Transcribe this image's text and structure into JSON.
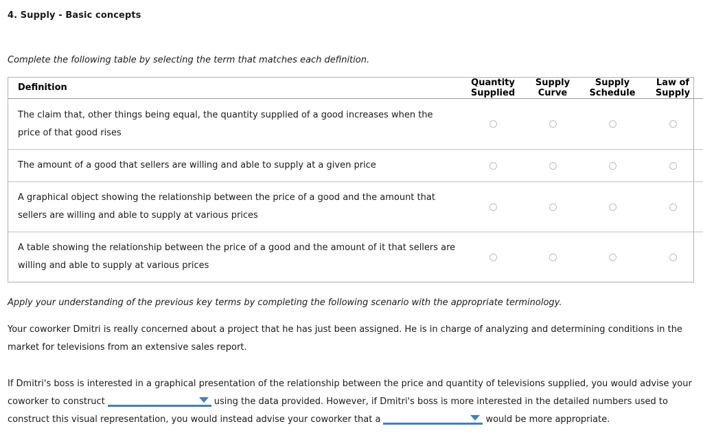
{
  "page": {
    "title": "4. Supply - Basic concepts",
    "instruction": "Complete the following table by selecting the term that matches each definition."
  },
  "table": {
    "definition_header": "Definition",
    "columns": [
      "Quantity Supplied",
      "Supply Curve",
      "Supply Schedule",
      "Law of Supply"
    ],
    "columns_split": [
      {
        "line1": "Quantity",
        "line2": "Supplied"
      },
      {
        "line1": "Supply",
        "line2": "Curve"
      },
      {
        "line1": "Supply",
        "line2": "Schedule"
      },
      {
        "line1": "Law of",
        "line2": "Supply"
      }
    ],
    "rows": [
      {
        "definition": "The claim that, other things being equal, the quantity supplied of a good increases when the price of that good rises",
        "selected": null
      },
      {
        "definition": "The amount of a good that sellers are willing and able to supply at a given price",
        "selected": null
      },
      {
        "definition": "A graphical object showing the relationship between the price of a good and the amount that sellers are willing and able to supply at various prices",
        "selected": null
      },
      {
        "definition": "A table showing the relationship between the price of a good and the amount of it that sellers are willing and able to supply at various prices",
        "selected": null
      }
    ]
  },
  "scenario": {
    "apply_line": "Apply your understanding of the previous key terms by completing the following scenario with the appropriate terminology.",
    "story": "Your coworker Dmitri is really concerned about a project that he has just been assigned. He is in charge of analyzing and determining conditions in the market for televisions from an extensive sales report.",
    "fill_part1": "If Dmitri's boss is interested in a graphical presentation of the relationship between the price and quantity of televisions supplied, you would advise your coworker to construct",
    "fill_part2": "using the data provided. However, if Dmitri's boss is more interested in the detailed numbers used to construct this visual representation, you would instead advise your coworker that a",
    "fill_part3": "would be more appropriate.",
    "dropdown1_value": "",
    "dropdown2_value": ""
  },
  "colors": {
    "accent": "#3f7fbf",
    "table_border": "#b0b0b0",
    "row_divider": "#c2c2c2",
    "radio_border": "#bdbdbd",
    "text": "#1a1a1a"
  }
}
